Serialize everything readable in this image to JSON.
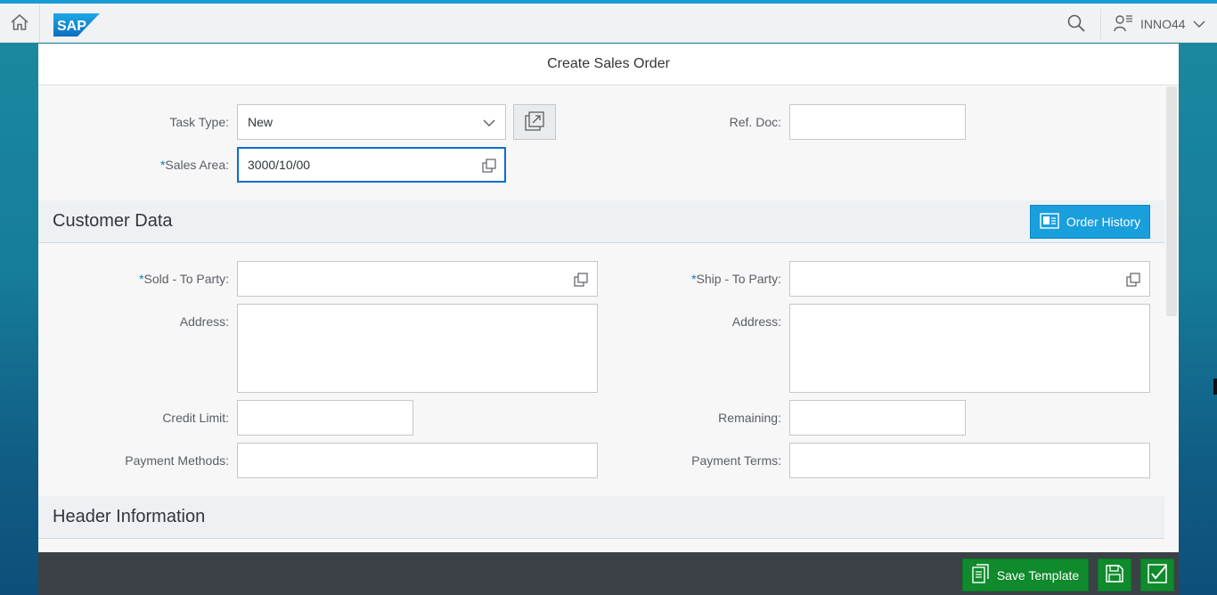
{
  "shell": {
    "logo_text": "SAP",
    "user_name": "INNO44",
    "icons": [
      "home-icon",
      "search-icon",
      "user-menu-icon",
      "chevron-down-icon"
    ]
  },
  "app": {
    "title": "Create Sales Order"
  },
  "top_form": {
    "task_type": {
      "label": "Task Type:",
      "value": "New"
    },
    "sales_area": {
      "label": "Sales Area:",
      "required_mark": "*",
      "value": "3000/10/00"
    },
    "ref_doc": {
      "label": "Ref. Doc:",
      "value": ""
    }
  },
  "customer_data": {
    "title": "Customer Data",
    "order_history_label": "Order History",
    "sold_to_party": {
      "label": "Sold - To Party:",
      "required_mark": "*",
      "value": ""
    },
    "ship_to_party": {
      "label": "Ship - To Party:",
      "required_mark": "*",
      "value": ""
    },
    "address_left": {
      "label": "Address:",
      "value": ""
    },
    "address_right": {
      "label": "Address:",
      "value": ""
    },
    "credit_limit": {
      "label": "Credit Limit:",
      "value": ""
    },
    "remaining": {
      "label": "Remaining:",
      "value": ""
    },
    "payment_methods": {
      "label": "Payment Methods:",
      "value": ""
    },
    "payment_terms": {
      "label": "Payment Terms:",
      "value": ""
    }
  },
  "header_information": {
    "title": "Header Information"
  },
  "footer": {
    "save_template_label": "Save Template"
  },
  "colors": {
    "accent_blue": "#1a9fdd",
    "footer_bg": "#3c4147",
    "save_green": "#0f8a2c",
    "required": "#0a7dba"
  }
}
